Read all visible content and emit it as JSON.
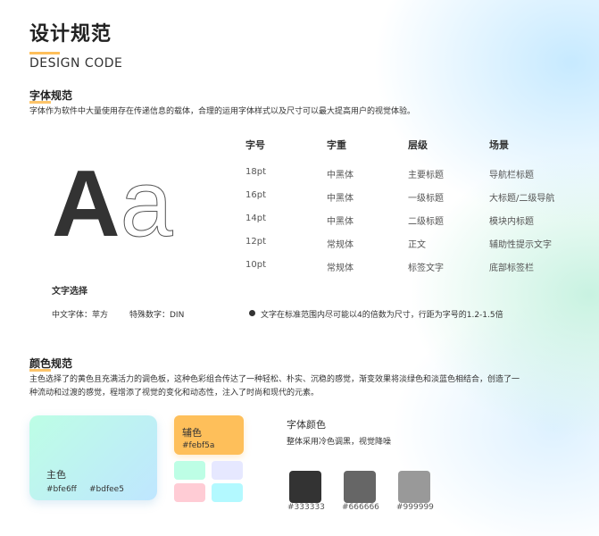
{
  "header": {
    "title_cn": "设计规范",
    "title_en": "DESIGN CODE"
  },
  "typography": {
    "title": "字体规范",
    "desc": "字体作为软件中大量使用存在传递信息的载体，合理的运用字体样式以及尺寸可以最大提高用户的视觉体验。",
    "sample_upper": "A",
    "sample_lower": "a",
    "columns": [
      "字号",
      "字重",
      "层级",
      "场景"
    ],
    "rows": [
      [
        "18pt",
        "中黑体",
        "主要标题",
        "导航栏标题"
      ],
      [
        "16pt",
        "中黑体",
        "一级标题",
        "大标题/二级导航"
      ],
      [
        "14pt",
        "中黑体",
        "二级标题",
        "模块内标题"
      ],
      [
        "12pt",
        "常规体",
        "正文",
        "辅助性提示文字"
      ],
      [
        "10pt",
        "常规体",
        "标签文字",
        "底部标签栏"
      ]
    ],
    "font_choice_title": "文字选择",
    "cn_font": "中文字体：苹方",
    "num_font": "特殊数字：DIN",
    "note": "文字在标准范围内尽可能以4的倍数为尺寸，行距为字号的1.2-1.5倍"
  },
  "color": {
    "title": "颜色规范",
    "desc_line1": "主色选择了的黄色且充满活力的调色板，这种色彩组合传达了一种轻松、朴实、沉稳的感觉，渐变效果将淡绿色和淡蓝色相结合，创造了一",
    "desc_line2": "种流动和过渡的感觉，程增添了视觉的变化和动态性，注入了时尚和现代的元素。",
    "main": {
      "label": "主色",
      "hex1": "#bfe6ff",
      "hex2": "#bdfee5"
    },
    "aux": {
      "label": "辅色",
      "hex": "#febf5a"
    },
    "mini_swatches": [
      "#bdfee5",
      "#e6e8ff",
      "#ffccd5",
      "#b3f9ff"
    ],
    "font_color_title": "字体颜色",
    "font_color_desc": "整体采用冷色调黑，视觉降噪",
    "font_colors": [
      "#333333",
      "#666666",
      "#999999"
    ]
  }
}
